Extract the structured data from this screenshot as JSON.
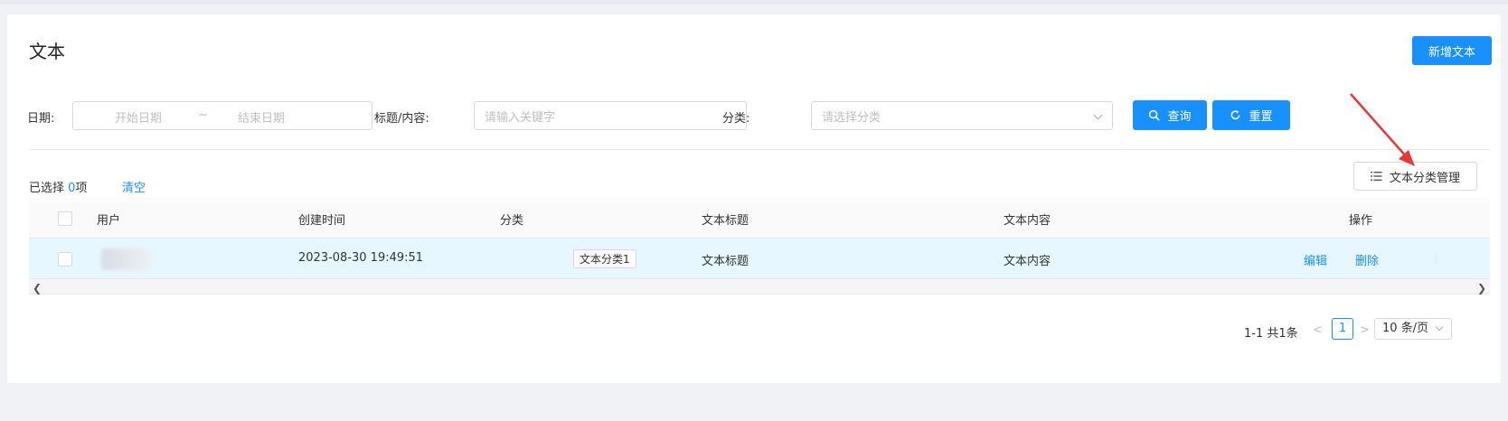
{
  "page": {
    "title": "文本",
    "add_button": "新增文本"
  },
  "filters": {
    "date_label": "日期:",
    "date_start_placeholder": "开始日期",
    "date_sep": "~",
    "date_end_placeholder": "结束日期",
    "keyword_label": "标题/内容:",
    "keyword_placeholder": "请输入关键字",
    "category_label": "分类:",
    "category_placeholder": "请选择分类",
    "query_button": "查询",
    "reset_button": "重置"
  },
  "toolbar": {
    "selected_prefix": "已选择 ",
    "selected_count": "0",
    "selected_suffix": "项",
    "clear_link": "清空",
    "category_manage_button": "文本分类管理"
  },
  "table": {
    "columns": [
      "用户",
      "创建时间",
      "分类",
      "文本标题",
      "文本内容",
      "操作"
    ],
    "rows": [
      {
        "created": "2023-08-30 19:49:51",
        "category": "文本分类1",
        "title": "文本标题",
        "content": "文本内容",
        "edit": "编辑",
        "delete": "删除"
      }
    ]
  },
  "pagination": {
    "total": "1-1 共1条",
    "prev": "<",
    "current": "1",
    "next": ">",
    "page_size": "10 条/页"
  },
  "colors": {
    "primary": "#1890ff",
    "row_selected": "#e6f7ff"
  }
}
